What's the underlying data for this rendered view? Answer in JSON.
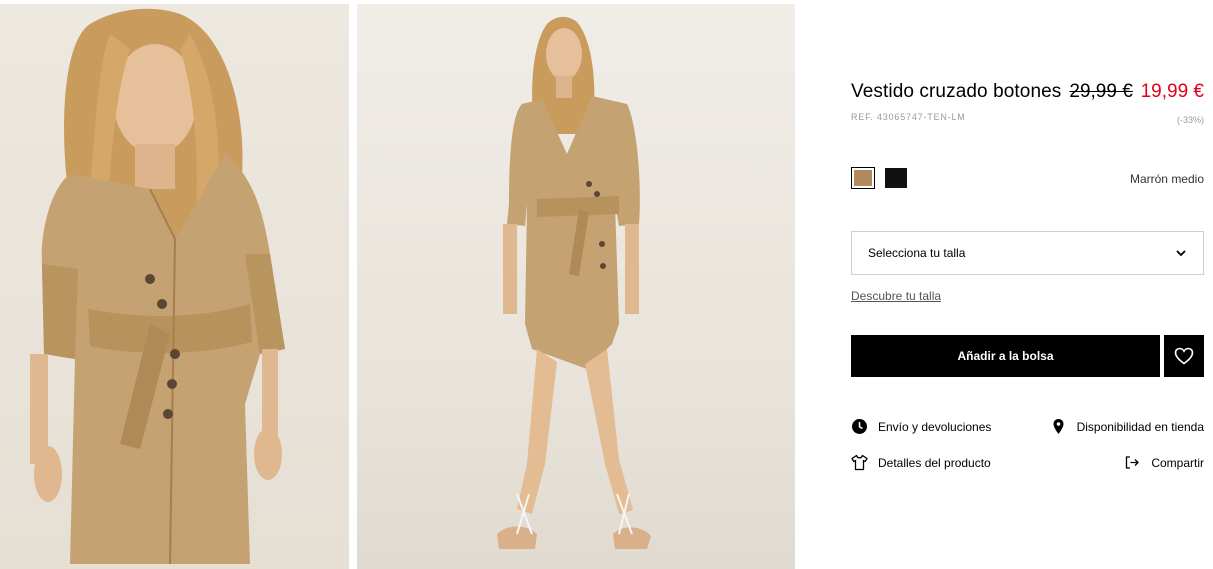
{
  "product": {
    "title": "Vestido cruzado botones",
    "old_price": "29,99 €",
    "new_price": "19,99 €",
    "ref": "REF. 43065747-TEN-LM",
    "discount": "(-33%)"
  },
  "colors": {
    "selected_name": "Marrón medio",
    "options": [
      {
        "name": "marron-medio",
        "hex": "#b08a5c",
        "selected": true
      },
      {
        "name": "negro",
        "hex": "#111111",
        "selected": false
      }
    ]
  },
  "size": {
    "placeholder": "Selecciona tu talla",
    "guide_link": "Descubre tu talla"
  },
  "actions": {
    "add_to_bag": "Añadir a la bolsa"
  },
  "links": {
    "shipping": "Envío y devoluciones",
    "store_availability": "Disponibilidad en tienda",
    "product_details": "Detalles del producto",
    "share": "Compartir"
  },
  "icons": {
    "shipping": "clock-icon",
    "store_availability": "location-pin-icon",
    "product_details": "tshirt-icon",
    "share": "share-icon",
    "favorite": "heart-icon",
    "dropdown": "chevron-down-icon"
  },
  "theme": {
    "sale_color": "#e3001b",
    "button_color": "#000000",
    "dress_color": "#c4a271"
  }
}
